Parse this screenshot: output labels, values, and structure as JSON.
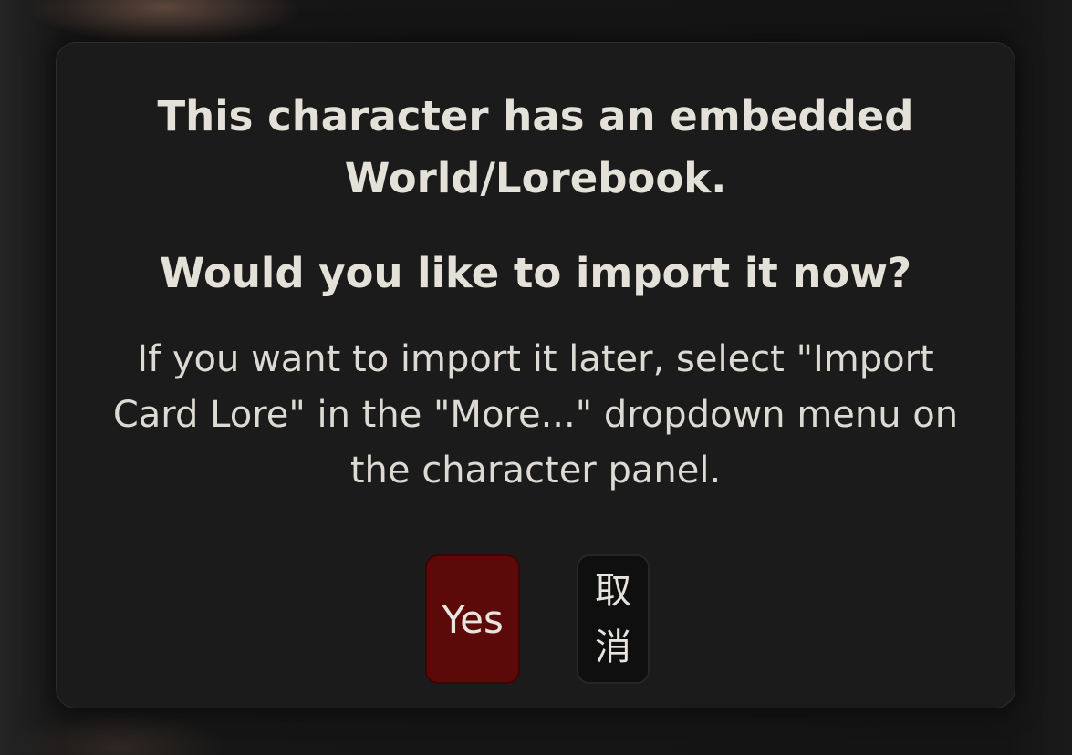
{
  "dialog": {
    "title_line": "This character has an embedded World/Lorebook.",
    "question": "Would you like to import it now?",
    "message": "If you want to import it later, select \"Import Card Lore\" in the \"More...\" dropdown menu on the character panel.",
    "buttons": {
      "yes_label": "Yes",
      "cancel_label": "取消"
    },
    "colors": {
      "yes_button": "#5c0909",
      "cancel_button": "#0f0f0f",
      "dialog_background": "#1b1b1b"
    }
  }
}
